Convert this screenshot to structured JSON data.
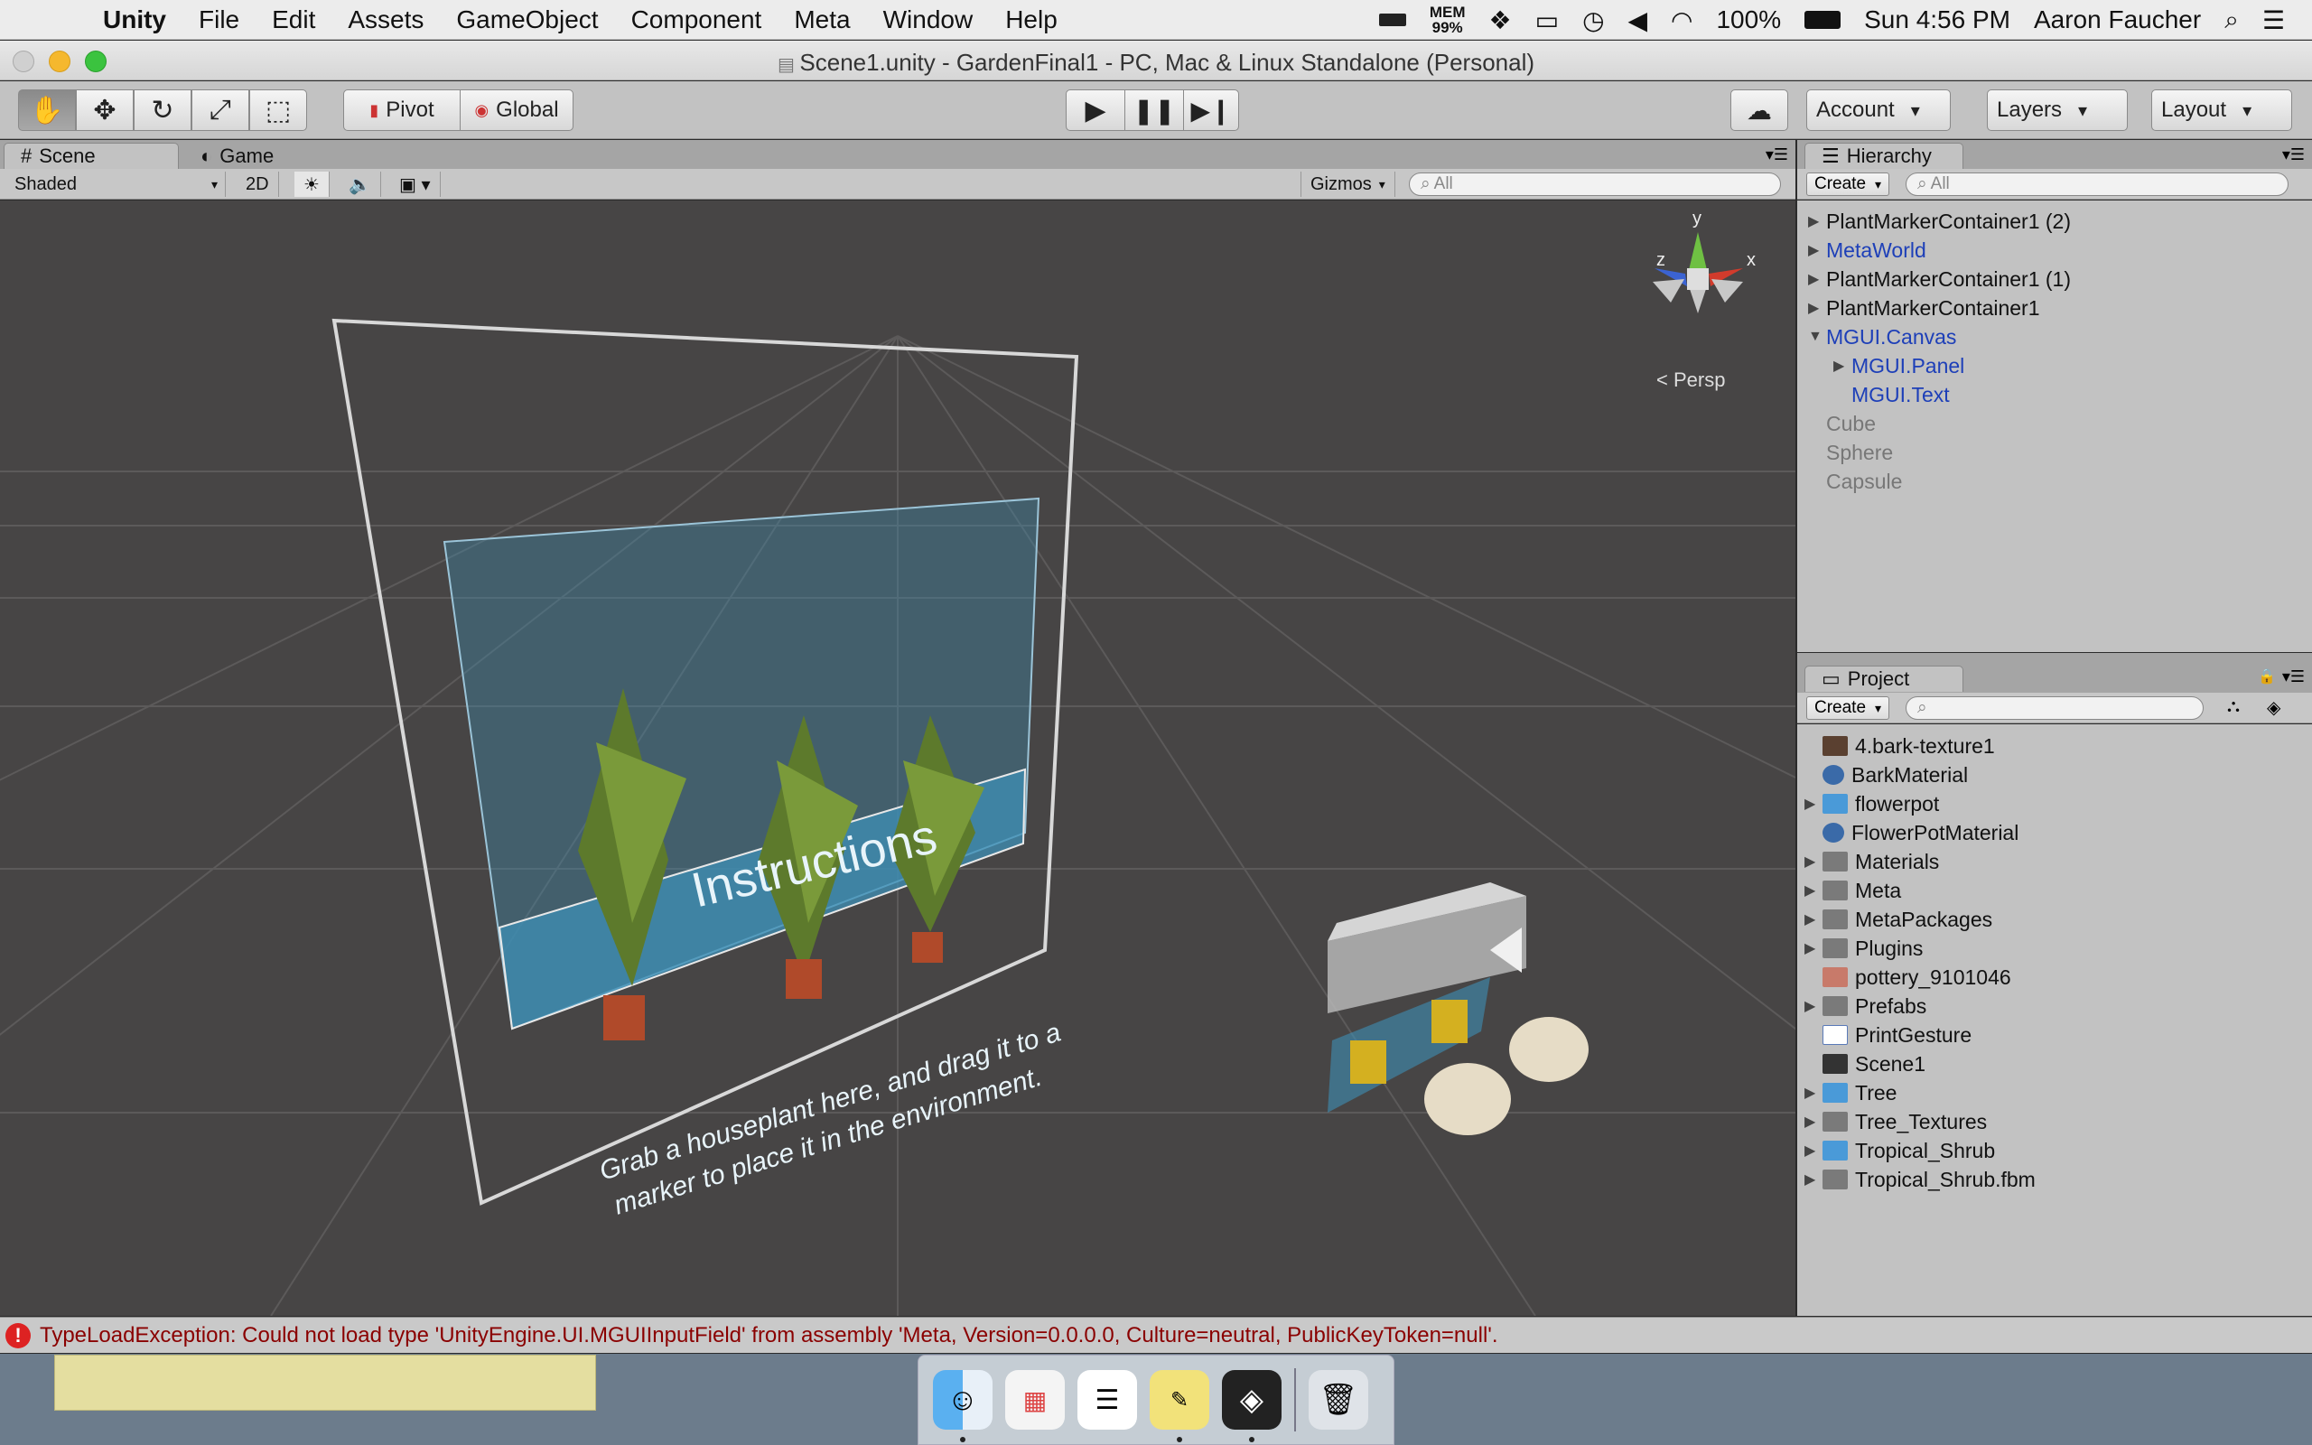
{
  "menubar": {
    "app": "Unity",
    "items": [
      "File",
      "Edit",
      "Assets",
      "GameObject",
      "Component",
      "Meta",
      "Window",
      "Help"
    ],
    "mem_label": "MEM",
    "mem_value": "99%",
    "battery": "100%",
    "clock": "Sun 4:56 PM",
    "user": "Aaron Faucher"
  },
  "window": {
    "title": "Scene1.unity - GardenFinal1 - PC, Mac & Linux Standalone (Personal)"
  },
  "toolbar": {
    "pivot": "Pivot",
    "global": "Global",
    "account": "Account",
    "layers": "Layers",
    "layout": "Layout"
  },
  "scene": {
    "tab_scene": "Scene",
    "tab_game": "Game",
    "shading": "Shaded",
    "mode_2d": "2D",
    "gizmos": "Gizmos",
    "search_placeholder": "All",
    "persp": "Persp",
    "axis_x": "x",
    "axis_y": "y",
    "axis_z": "z",
    "canvas_title": "Instructions",
    "canvas_line1": "Grab a houseplant here, and drag it to a",
    "canvas_line2": "marker to place it in the environment."
  },
  "hierarchy": {
    "tab": "Hierarchy",
    "create": "Create",
    "search_placeholder": "All",
    "items": [
      {
        "label": "PlantMarkerContainer1 (2)"
      },
      {
        "label": "MetaWorld"
      },
      {
        "label": "PlantMarkerContainer1 (1)"
      },
      {
        "label": "PlantMarkerContainer1"
      },
      {
        "label": "MGUI.Canvas"
      },
      {
        "label": "MGUI.Panel"
      },
      {
        "label": "MGUI.Text"
      },
      {
        "label": "Cube"
      },
      {
        "label": "Sphere"
      },
      {
        "label": "Capsule"
      }
    ]
  },
  "project": {
    "tab": "Project",
    "create": "Create",
    "items": [
      {
        "label": "4.bark-texture1"
      },
      {
        "label": "BarkMaterial"
      },
      {
        "label": "flowerpot"
      },
      {
        "label": "FlowerPotMaterial"
      },
      {
        "label": "Materials"
      },
      {
        "label": "Meta"
      },
      {
        "label": "MetaPackages"
      },
      {
        "label": "Plugins"
      },
      {
        "label": "pottery_9101046"
      },
      {
        "label": "Prefabs"
      },
      {
        "label": "PrintGesture"
      },
      {
        "label": "Scene1"
      },
      {
        "label": "Tree"
      },
      {
        "label": "Tree_Textures"
      },
      {
        "label": "Tropical_Shrub"
      },
      {
        "label": "Tropical_Shrub.fbm"
      }
    ]
  },
  "status": {
    "message": "TypeLoadException: Could not load type 'UnityEngine.UI.MGUIInputField' from assembly 'Meta, Version=0.0.0.0, Culture=neutral, PublicKeyToken=null'."
  },
  "colors": {
    "error": "#8a0000",
    "hierarchy_prefab": "#1d3fb8",
    "hierarchy_disabled": "#777777",
    "selection_panel": "#3d8fb5"
  }
}
